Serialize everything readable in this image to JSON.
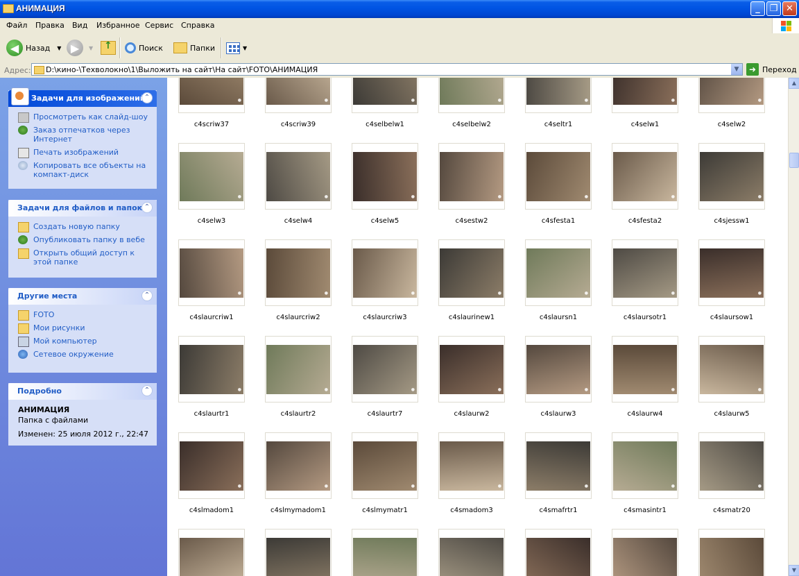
{
  "window": {
    "title": "АНИМАЦИЯ",
    "min": "_",
    "max": "❐",
    "close": "✕"
  },
  "menu": [
    "Файл",
    "Правка",
    "Вид",
    "Избранное",
    "Сервис",
    "Справка"
  ],
  "toolbar": {
    "back": "Назад",
    "search": "Поиск",
    "folders": "Папки"
  },
  "address": {
    "label": "Адрес:",
    "path": "D:\\кино-\\Техволокно\\1\\Выложить на сайт\\На сайт\\FOTO\\АНИМАЦИЯ",
    "go": "Переход"
  },
  "sidebar": {
    "image_tasks": {
      "title": "Задачи для изображений",
      "items": [
        "Просмотреть как слайд-шоу",
        "Заказ отпечатков через Интернет",
        "Печать изображений",
        "Копировать все объекты на компакт-диск"
      ]
    },
    "file_tasks": {
      "title": "Задачи для файлов и папок",
      "items": [
        "Создать новую папку",
        "Опубликовать папку в вебе",
        "Открыть общий доступ к этой папке"
      ]
    },
    "other_places": {
      "title": "Другие места",
      "items": [
        "FOTO",
        "Мои рисунки",
        "Мой компьютер",
        "Сетевое окружение"
      ]
    },
    "details": {
      "title": "Подробно",
      "name": "АНИМАЦИЯ",
      "type": "Папка с файлами",
      "modified": "Изменен: 25 июля 2012 г., 22:47"
    }
  },
  "files": [
    [
      "c4scriw37",
      "c4scriw39",
      "c4selbelw1",
      "c4selbelw2",
      "c4seltr1",
      "c4selw1",
      "c4selw2"
    ],
    [
      "c4selw3",
      "c4selw4",
      "c4selw5",
      "c4sestw2",
      "c4sfesta1",
      "c4sfesta2",
      "c4sjessw1"
    ],
    [
      "c4slaurcriw1",
      "c4slaurcriw2",
      "c4slaurcriw3",
      "c4slaurinew1",
      "c4slaursn1",
      "c4slaursotr1",
      "c4slaursow1"
    ],
    [
      "c4slaurtr1",
      "c4slaurtr2",
      "c4slaurtr7",
      "c4slaurw2",
      "c4slaurw3",
      "c4slaurw4",
      "c4slaurw5"
    ],
    [
      "c4slmadom1",
      "c4slmymadom1",
      "c4slmymatr1",
      "c4smadom3",
      "c4smafrtr1",
      "c4smasintr1",
      "c4smatr20"
    ],
    [
      "",
      "",
      "",
      "",
      "",
      "",
      ""
    ]
  ]
}
